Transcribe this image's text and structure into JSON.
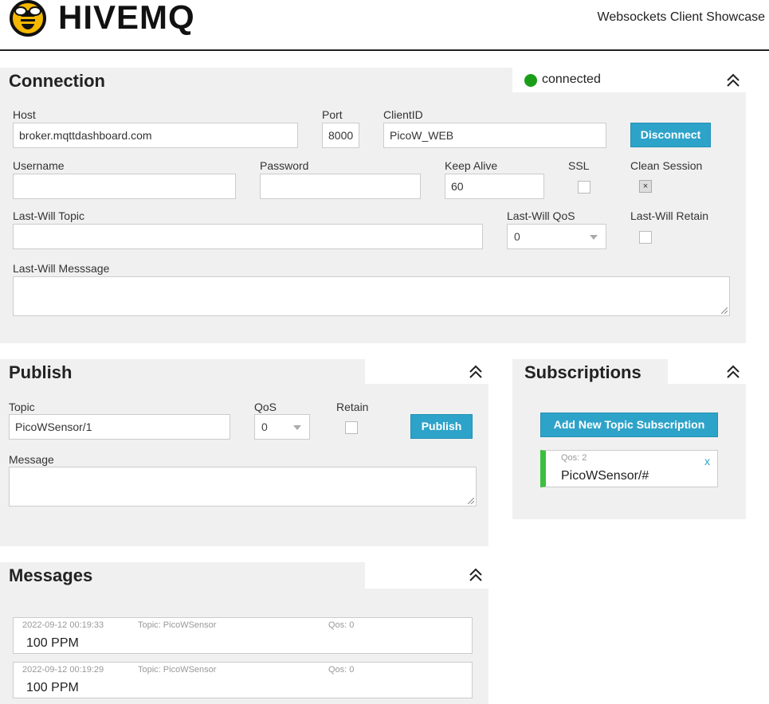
{
  "header": {
    "brand": "HIVEMQ",
    "subtitle": "Websockets Client Showcase"
  },
  "connection": {
    "title": "Connection",
    "status": "connected",
    "status_color": "#1a9e1a",
    "host_label": "Host",
    "host_value": "broker.mqttdashboard.com",
    "port_label": "Port",
    "port_value": "8000",
    "clientid_label": "ClientID",
    "clientid_value": "PicoW_WEB",
    "disconnect_label": "Disconnect",
    "username_label": "Username",
    "username_value": "",
    "password_label": "Password",
    "password_value": "",
    "keepalive_label": "Keep Alive",
    "keepalive_value": "60",
    "ssl_label": "SSL",
    "ssl_checked": false,
    "clean_label": "Clean Session",
    "clean_checked": true,
    "clean_mark": "×",
    "lwt_topic_label": "Last-Will Topic",
    "lwt_topic_value": "",
    "lwt_qos_label": "Last-Will QoS",
    "lwt_qos_value": "0",
    "lwt_retain_label": "Last-Will Retain",
    "lwt_retain_checked": false,
    "lwt_message_label": "Last-Will Messsage",
    "lwt_message_value": ""
  },
  "publish": {
    "title": "Publish",
    "topic_label": "Topic",
    "topic_value": "PicoWSensor/1",
    "qos_label": "QoS",
    "qos_value": "0",
    "retain_label": "Retain",
    "retain_checked": false,
    "publish_label": "Publish",
    "message_label": "Message",
    "message_value": ""
  },
  "subscriptions": {
    "title": "Subscriptions",
    "add_label": "Add New Topic Subscription",
    "items": [
      {
        "qos": "Qos: 2",
        "topic": "PicoWSensor/#",
        "remove": "x",
        "color": "#3cbf3c"
      }
    ]
  },
  "messages": {
    "title": "Messages",
    "items": [
      {
        "time": "2022-09-12 00:19:33",
        "topic": "Topic: PicoWSensor",
        "qos": "Qos: 0",
        "payload": "100 PPM"
      },
      {
        "time": "2022-09-12 00:19:29",
        "topic": "Topic: PicoWSensor",
        "qos": "Qos: 0",
        "payload": "100 PPM"
      }
    ]
  },
  "icons": {
    "logo": "bee-logo-icon",
    "collapse": "double-chevron-up-icon",
    "status": "green-dot-icon"
  }
}
